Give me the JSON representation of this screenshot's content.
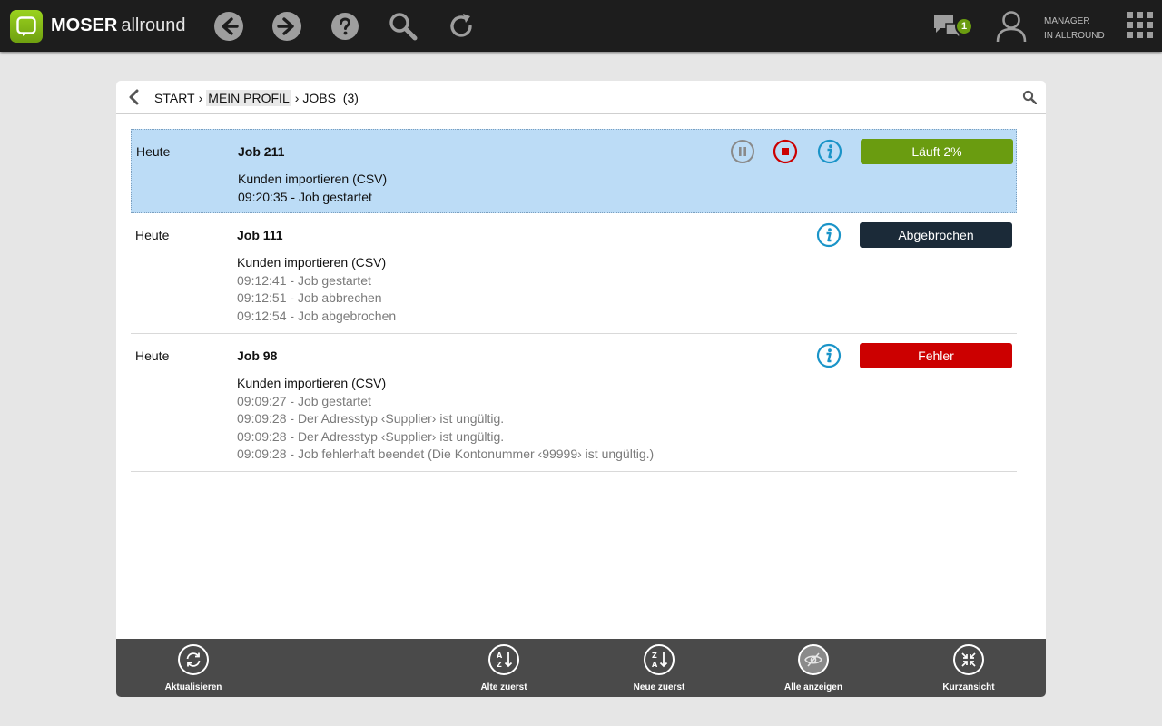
{
  "app": {
    "brand_bold": "MOSER",
    "brand_light": "allround",
    "notifications_count": "1",
    "user_line1": "MANAGER",
    "user_line2": "IN ALLROUND"
  },
  "breadcrumb": {
    "items": [
      "START",
      "MEIN PROFIL",
      "JOBS"
    ],
    "separator": "›",
    "count": "(3)"
  },
  "jobs": [
    {
      "date": "Heute",
      "title": "Job 211",
      "lines": [
        "Kunden importieren (CSV)",
        "09:20:35 - Job gestartet"
      ],
      "status": "Läuft 2%",
      "status_color": "#6a9c10",
      "selected": true
    },
    {
      "date": "Heute",
      "title": "Job 111",
      "lines": [
        "Kunden importieren (CSV)",
        "09:12:41 - Job gestartet",
        "09:12:51 - Job abbrechen",
        "09:12:54 - Job abgebrochen"
      ],
      "status": "Abgebrochen",
      "status_color": "#1b2a38",
      "selected": false
    },
    {
      "date": "Heute",
      "title": "Job 98",
      "lines": [
        "Kunden importieren (CSV)",
        "09:09:27 - Job gestartet",
        "09:09:28 - Der Adresstyp ‹Supplier› ist ungültig.",
        "09:09:28 - Der Adresstyp ‹Supplier› ist ungültig.",
        "09:09:28 - Job fehlerhaft beendet (Die Kontonummer ‹99999› ist ungültig.)"
      ],
      "status": "Fehler",
      "status_color": "#cc0000",
      "selected": false
    }
  ],
  "bottombar": {
    "refresh": "Aktualisieren",
    "oldest_first": "Alte zuerst",
    "newest_first": "Neue zuerst",
    "show_all": "Alle anzeigen",
    "compact_view": "Kurzansicht"
  },
  "colors": {
    "accent_green": "#6a9c10",
    "info_blue": "#1a94c8",
    "stop_red": "#cc0000"
  }
}
